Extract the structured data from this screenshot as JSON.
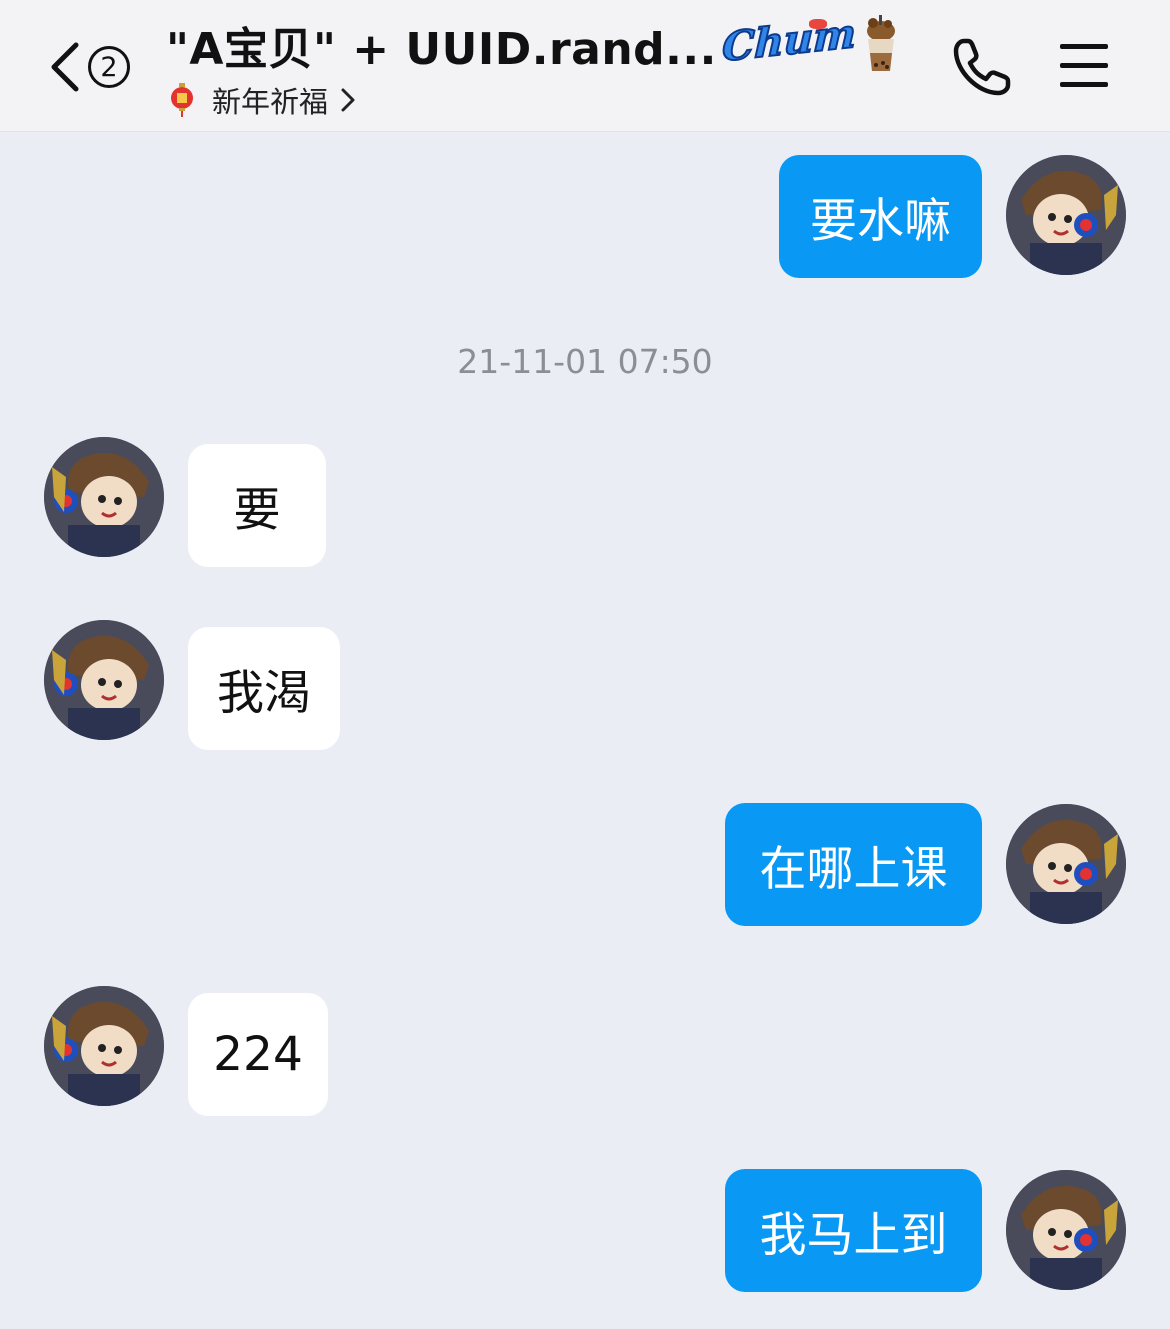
{
  "header": {
    "back_badge": "2",
    "title": "\"A宝贝\" + UUID.rand...",
    "title_badge_text": "Chum",
    "subtitle": "新年祈福",
    "icons": {
      "back": "chevron-left-icon",
      "call": "phone-icon",
      "menu": "hamburger-menu-icon",
      "subtitle_icon": "lantern-icon",
      "drink": "bubble-tea-icon"
    }
  },
  "messages": [
    {
      "direction": "outgoing",
      "text": "要水嘛"
    },
    {
      "direction": "incoming",
      "text": "要"
    },
    {
      "direction": "incoming",
      "text": "我渴"
    },
    {
      "direction": "outgoing",
      "text": "在哪上课"
    },
    {
      "direction": "incoming",
      "text": "224"
    },
    {
      "direction": "outgoing",
      "text": "我马上到"
    }
  ],
  "timestamp": "21-11-01 07:50",
  "colors": {
    "outgoing_bubble": "#0a98f5",
    "incoming_bubble": "#ffffff",
    "background": "#ebedf5",
    "header_bg": "#f3f3f6"
  }
}
